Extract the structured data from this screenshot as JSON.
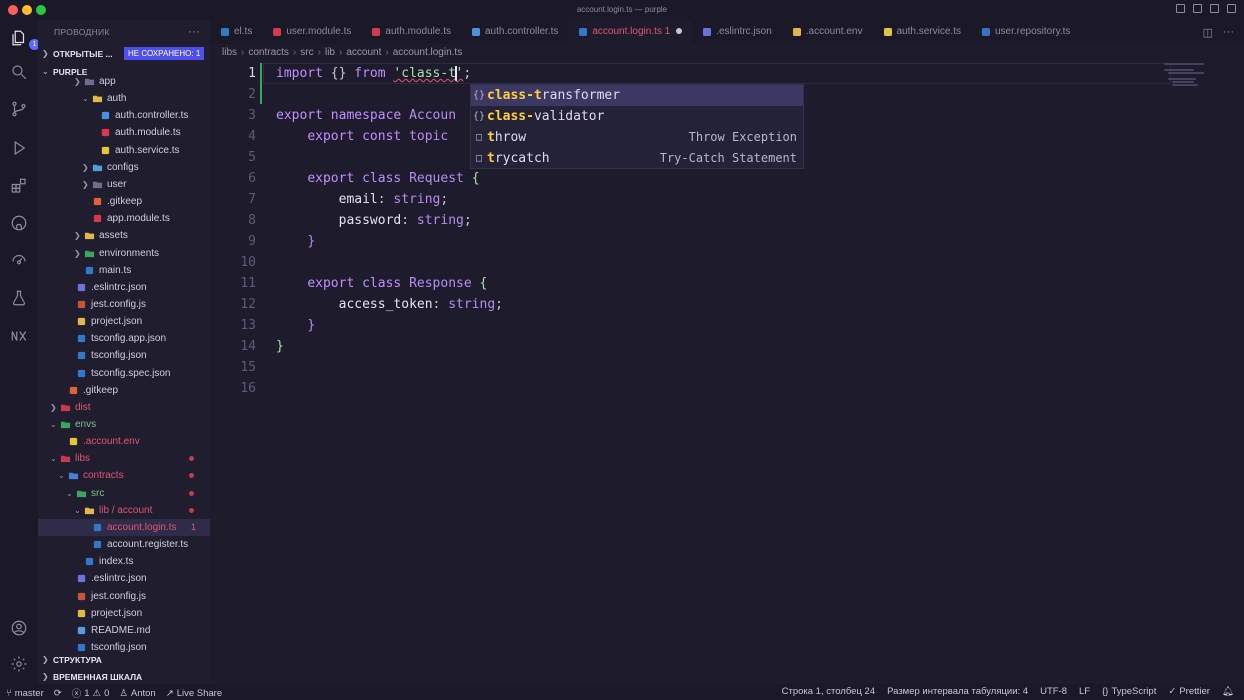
{
  "window": {
    "title": "account.login.ts — purple"
  },
  "explorer": {
    "title": "ПРОВОДНИК",
    "open_editors_label": "ОТКРЫТЫЕ ...",
    "unsaved_badge": "НЕ СОХРАНЕНО: 1",
    "root_label": "PURPLE",
    "outline_label": "СТРУКТУРА",
    "timeline_label": "ВРЕМЕННАЯ ШКАЛА",
    "activity_badge": "1",
    "tree": [
      {
        "name": "app",
        "indent": 3,
        "type": "folder"
      },
      {
        "name": "auth",
        "indent": 4,
        "type": "folder-open"
      },
      {
        "name": "auth.controller.ts",
        "indent": 5,
        "type": "nest"
      },
      {
        "name": "auth.module.ts",
        "indent": 5,
        "type": "nest-red"
      },
      {
        "name": "auth.service.ts",
        "indent": 5,
        "type": "nest-yellow"
      },
      {
        "name": "configs",
        "indent": 4,
        "type": "folder-cfg"
      },
      {
        "name": "user",
        "indent": 4,
        "type": "folder"
      },
      {
        "name": ".gitkeep",
        "indent": 4,
        "type": "git"
      },
      {
        "name": "app.module.ts",
        "indent": 4,
        "type": "nest-red"
      },
      {
        "name": "assets",
        "indent": 3,
        "type": "folder-yellow"
      },
      {
        "name": "environments",
        "indent": 3,
        "type": "folder-green"
      },
      {
        "name": "main.ts",
        "indent": 3,
        "type": "ts"
      },
      {
        "name": ".eslintrc.json",
        "indent": 2,
        "type": "eslint"
      },
      {
        "name": "jest.config.js",
        "indent": 2,
        "type": "jest"
      },
      {
        "name": "project.json",
        "indent": 2,
        "type": "json"
      },
      {
        "name": "tsconfig.app.json",
        "indent": 2,
        "type": "tsconfig"
      },
      {
        "name": "tsconfig.json",
        "indent": 2,
        "type": "tsconfig"
      },
      {
        "name": "tsconfig.spec.json",
        "indent": 2,
        "type": "tsconfig"
      },
      {
        "name": ".gitkeep",
        "indent": 1,
        "type": "git"
      },
      {
        "name": "dist",
        "indent": 0,
        "type": "folder-red"
      },
      {
        "name": "envs",
        "indent": 0,
        "type": "folder-green"
      },
      {
        "name": ".account.env",
        "indent": 1,
        "type": "env"
      },
      {
        "name": "libs",
        "indent": 0,
        "type": "folder-lib"
      },
      {
        "name": "contracts",
        "indent": 1,
        "type": "folder-blue"
      },
      {
        "name": "src",
        "indent": 2,
        "type": "folder-green"
      },
      {
        "name": "lib / account",
        "indent": 3,
        "type": "folder-open"
      },
      {
        "name": "account.login.ts",
        "indent": 4,
        "type": "ts"
      },
      {
        "name": "account.register.ts",
        "indent": 4,
        "type": "ts"
      },
      {
        "name": "index.ts",
        "indent": 3,
        "type": "ts"
      },
      {
        "name": ".eslintrc.json",
        "indent": 2,
        "type": "eslint"
      },
      {
        "name": "jest.config.js",
        "indent": 2,
        "type": "jest"
      },
      {
        "name": "project.json",
        "indent": 2,
        "type": "json"
      },
      {
        "name": "README.md",
        "indent": 2,
        "type": "info"
      },
      {
        "name": "tsconfig.json",
        "indent": 2,
        "type": "tsconfig"
      }
    ],
    "selected_error_count": "1"
  },
  "tabs": [
    {
      "label": "el.ts"
    },
    {
      "label": "user.module.ts"
    },
    {
      "label": "auth.module.ts"
    },
    {
      "label": "auth.controller.ts"
    },
    {
      "label": "account.login.ts 1",
      "active": true
    },
    {
      "label": ".eslintrc.json"
    },
    {
      "label": ".account.env"
    },
    {
      "label": "auth.service.ts"
    },
    {
      "label": "user.repository.ts"
    }
  ],
  "breadcrumb": [
    "libs",
    "contracts",
    "src",
    "lib",
    "account",
    "account.login.ts"
  ],
  "code": {
    "line_numbers": [
      "1",
      "2",
      "3",
      "4",
      "5",
      "6",
      "7",
      "8",
      "9",
      "10",
      "11",
      "12",
      "13",
      "14",
      "15",
      "16"
    ],
    "l1": {
      "kw": "import",
      "braces": " {} ",
      "from": "from",
      "str": "'class-t'",
      "semi": ";"
    },
    "l3": {
      "kw": "export",
      "ns": " namespace",
      "name": " Accoun"
    },
    "l4": {
      "kw": "export",
      "c": " const",
      "name": " topic"
    },
    "l6": {
      "kw": "export",
      "c": " class",
      "name": " Request",
      "b": " {"
    },
    "l7": {
      "prop": "email",
      "colon": ": ",
      "type": "string",
      "semi": ";"
    },
    "l8": {
      "prop": "password",
      "colon": ": ",
      "type": "string",
      "semi": ";"
    },
    "l9": "}",
    "l11": {
      "kw": "export",
      "c": " class",
      "name": " Response",
      "b": " {"
    },
    "l12": {
      "prop": "access_token",
      "colon": ": ",
      "type": "string",
      "semi": ";"
    },
    "l13": "}",
    "l14": "}"
  },
  "suggest": [
    {
      "icon": "{}",
      "hl": "class-t",
      "rest": "ransformer",
      "detail": ""
    },
    {
      "icon": "{}",
      "hl": "class-",
      "rest": "validator",
      "detail": ""
    },
    {
      "icon": "□",
      "hl": "t",
      "rest": "hrow",
      "detail": "Throw Exception"
    },
    {
      "icon": "□",
      "hl": "t",
      "rest": "rycatch",
      "detail": "Try-Catch Statement"
    }
  ],
  "status": {
    "branch": "master",
    "errors": "1",
    "warnings": "0",
    "user": "Anton",
    "live_share": "Live Share",
    "position": "Строка 1, столбец 24",
    "tab_size": "Размер интервала табуляции: 4",
    "encoding": "UTF-8",
    "eol": "LF",
    "language": "TypeScript",
    "formatter": "Prettier"
  },
  "colors": {
    "accent": "#5b6bff",
    "error": "#e05670",
    "bg": "#1e1c2c"
  }
}
